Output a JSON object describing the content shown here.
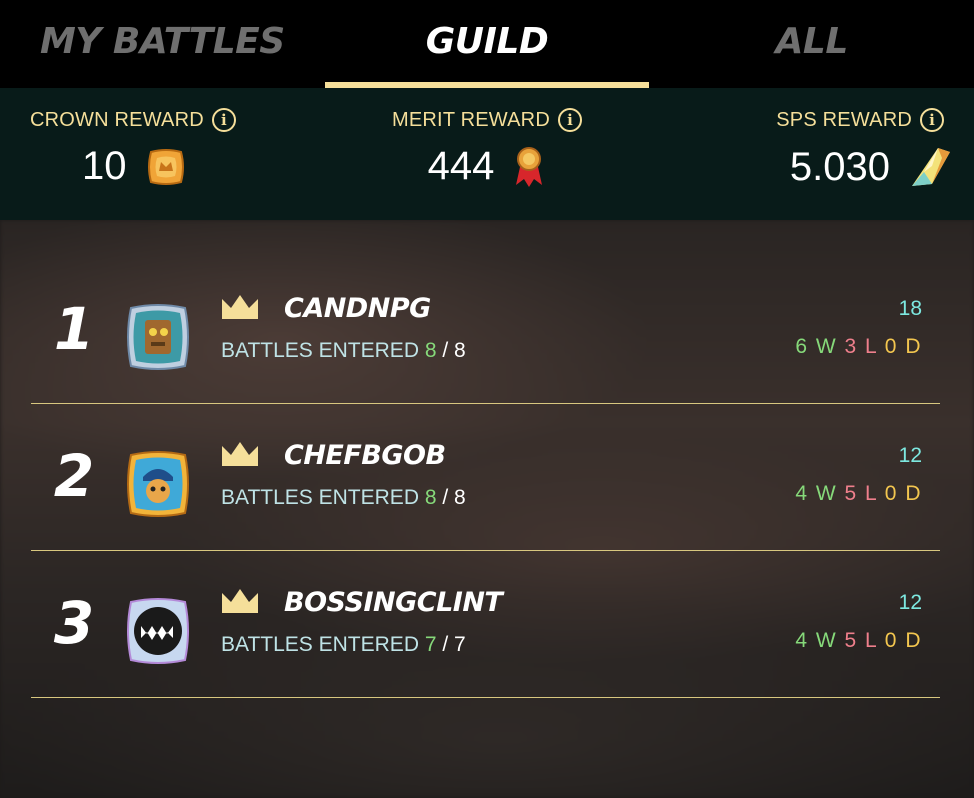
{
  "tabs": [
    {
      "label": "MY BATTLES",
      "active": false
    },
    {
      "label": "GUILD",
      "active": true
    },
    {
      "label": "ALL",
      "active": false
    }
  ],
  "rewards": [
    {
      "label": "CROWN REWARD",
      "value": "10",
      "icon": "crown-token-icon"
    },
    {
      "label": "MERIT REWARD",
      "value": "444",
      "icon": "merit-medal-icon"
    },
    {
      "label": "SPS REWARD",
      "value": "5.030",
      "icon": "sps-crystal-icon"
    }
  ],
  "players": [
    {
      "rank": "1",
      "name": "CANDNPG",
      "battles_label": "BATTLES ENTERED",
      "entered": "8",
      "total": "8",
      "score": "18",
      "wins": "6",
      "losses": "3",
      "draws": "0"
    },
    {
      "rank": "2",
      "name": "CHEFBGOB",
      "battles_label": "BATTLES ENTERED",
      "entered": "8",
      "total": "8",
      "score": "12",
      "wins": "4",
      "losses": "5",
      "draws": "0"
    },
    {
      "rank": "3",
      "name": "BOSSINGCLINT",
      "battles_label": "BATTLES ENTERED",
      "entered": "7",
      "total": "7",
      "score": "12",
      "wins": "4",
      "losses": "5",
      "draws": "0"
    }
  ],
  "labels": {
    "w": "W",
    "l": "L",
    "d": "D",
    "slash": "/"
  },
  "colors": {
    "accent": "#f5df9a",
    "win": "#86d97a",
    "loss": "#ef7f8c",
    "draw": "#f3c64f",
    "score": "#7de8e0"
  }
}
